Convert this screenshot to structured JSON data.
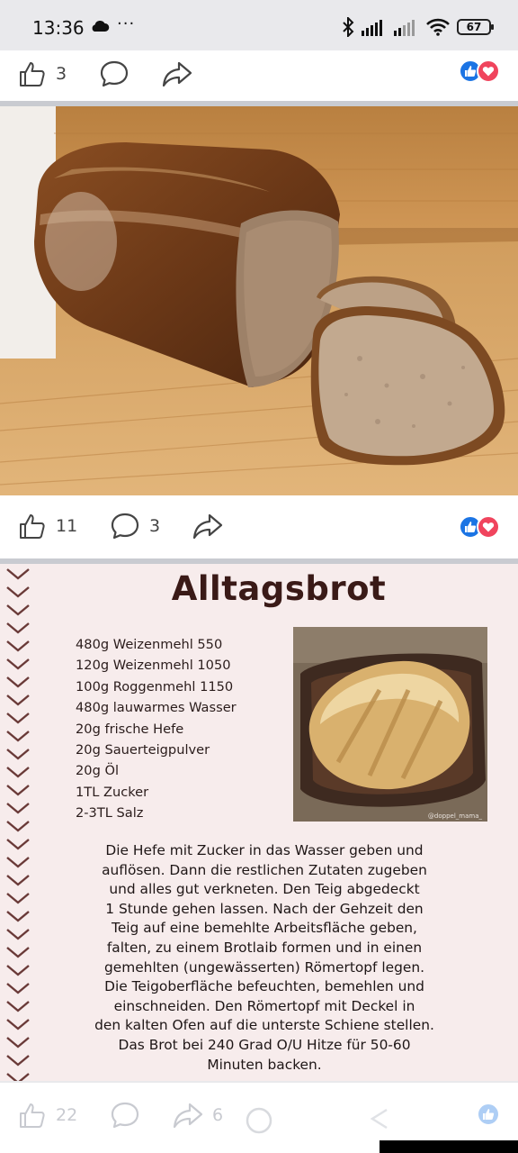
{
  "status_bar": {
    "time": "13:36",
    "dots": "···",
    "battery": "67",
    "icons": [
      "cloud-icon",
      "bluetooth-icon",
      "signal-icon",
      "signal-icon",
      "wifi-icon",
      "battery-icon"
    ]
  },
  "post1": {
    "like_count": "3",
    "icons": [
      "like-icon",
      "comment-icon",
      "share-icon"
    ],
    "reactions": [
      "like",
      "love"
    ]
  },
  "post2": {
    "like_count": "11",
    "comment_count": "3",
    "reactions": [
      "like",
      "love"
    ]
  },
  "recipe": {
    "title": "Alltagsbrot",
    "ingredients": [
      "480g Weizenmehl 550",
      "120g Weizenmehl 1050",
      "100g Roggenmehl 1150",
      "480g lauwarmes Wasser",
      "20g frische Hefe",
      "20g Sauerteigpulver",
      "20g Öl",
      "1TL Zucker",
      "2-3TL Salz"
    ],
    "photo_credit": "@doppel_mama_",
    "instructions": [
      "Die Hefe mit Zucker in das Wasser geben und",
      "auflösen. Dann die restlichen Zutaten zugeben",
      "und alles gut verkneten. Den Teig abgedeckt",
      "1 Stunde gehen lassen. Nach der Gehzeit den",
      "Teig auf eine bemehlte Arbeitsfläche geben,",
      "falten, zu einem Brotlaib formen und in einen",
      "gemehlten (ungewässerten) Römertopf legen.",
      "Die Teigoberfläche befeuchten, bemehlen und",
      "einschneiden. Den Römertopf mit Deckel in",
      "den kalten Ofen auf die unterste Schiene stellen.",
      "Das Brot bei 240 Grad O/U Hitze für 50-60",
      "Minuten backen."
    ]
  },
  "post3": {
    "like_count": "22",
    "share_count": "6"
  },
  "colors": {
    "like_blue": "#1b74e4",
    "love_red": "#f0445d",
    "recipe_bg": "#f7ecec",
    "recipe_text": "#3a1a17"
  }
}
